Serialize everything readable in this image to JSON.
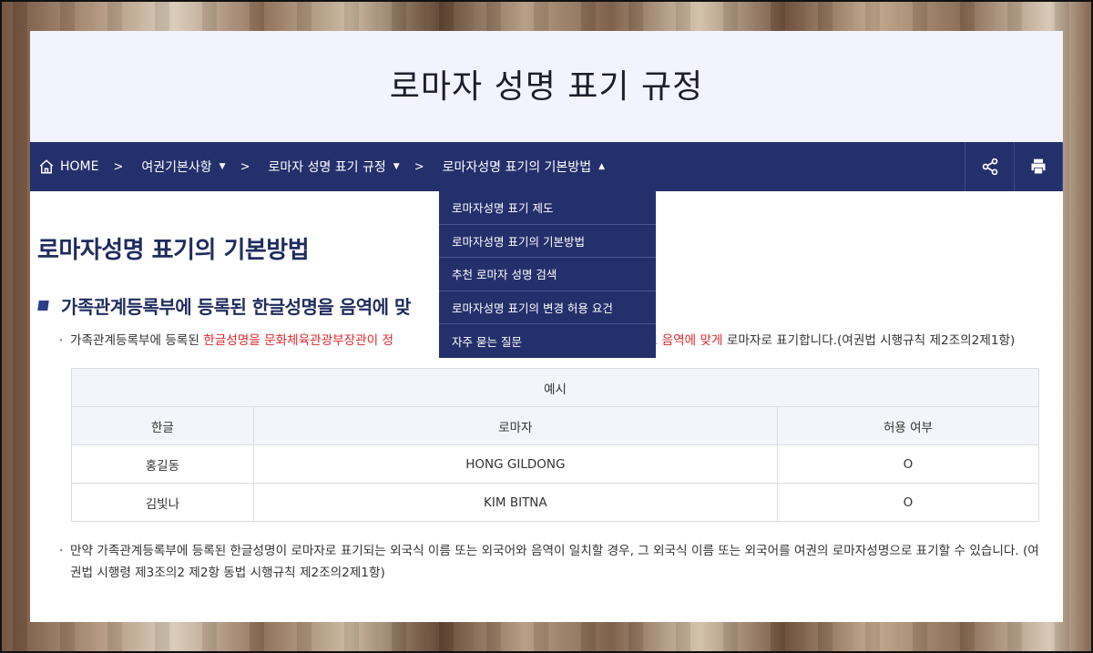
{
  "header": {
    "title": "로마자 성명 표기 규정"
  },
  "breadcrumb": {
    "home": "HOME",
    "items": [
      {
        "label": "여권기본사항",
        "caret": "▼"
      },
      {
        "label": "로마자 성명 표기 규정",
        "caret": "▼"
      },
      {
        "label": "로마자성명 표기의 기본방법",
        "caret": "▲"
      }
    ],
    "separator": ">"
  },
  "dropdown": {
    "items": [
      "로마자성명 표기 제도",
      "로마자성명 표기의 기본방법",
      "추천 로마자 성명 검색",
      "로마자성명 표기의 변경 허용 요건",
      "자주 묻는 질문"
    ]
  },
  "content": {
    "page_title": "로마자성명 표기의 기본방법",
    "section_title": "가족관계등록부에 등록된 한글성명을 음역에 맞",
    "bullet1": {
      "dot": "·",
      "before": "가족관계등록부에 등록된 ",
      "red1": "한글성명을 문화체육관광부장관이 정",
      "red2": "한 단위로 음역에 맞게",
      "after": " 로마자로 표기합니다.(여권법 시행규칙 제2조의2제1항)"
    },
    "table": {
      "caption": "예시",
      "headers": [
        "한글",
        "로마자",
        "허용 여부"
      ],
      "rows": [
        [
          "홍길동",
          "HONG GILDONG",
          "O"
        ],
        [
          "김빛나",
          "KIM BITNA",
          "O"
        ]
      ]
    },
    "bullet2": {
      "dot": "·",
      "text": "만약 가족관계등록부에 등록된 한글성명이 로마자로 표기되는 외국식 이름 또는 외국어와 음역이 일치할 경우, 그 외국식 이름 또는 외국어를 여권의 로마자성명으로 표기할 수 있습니다. (여권법 시행령 제3조의2 제2항 동법 시행규칙 제2조의2제1항)"
    }
  },
  "tools": {
    "share_icon": "share-icon",
    "print_icon": "print-icon"
  }
}
